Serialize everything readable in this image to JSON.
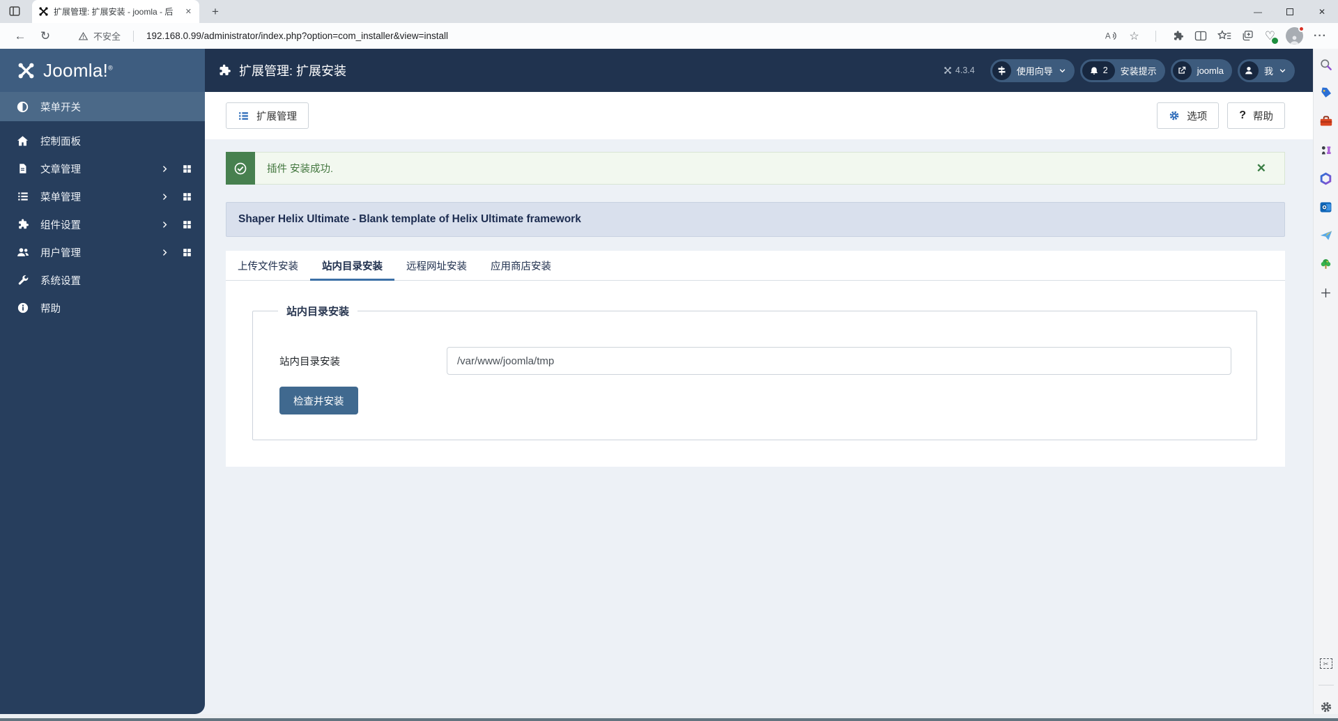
{
  "browser": {
    "tab": {
      "title": "扩展管理: 扩展安装 - joomla - 后"
    },
    "nav": {
      "security_label": "不安全",
      "url": "192.168.0.99/administrator/index.php?option=com_installer&view=install"
    }
  },
  "glyphs": {
    "back": "←",
    "refresh": "↻",
    "star": "☆",
    "dots": "···",
    "new_tab": "+",
    "close": "✕",
    "minimize": "—",
    "heart": "♡",
    "question": "?",
    "scissors": "✂"
  },
  "edge_sidebar": {
    "icons": [
      "search-icon",
      "shopping-tag-icon",
      "toolbox-icon",
      "games-icon",
      "microsoft-365-icon",
      "outlook-icon",
      "paper-plane-icon",
      "tree-icon",
      "add-icon",
      "screenshot-icon",
      "settings-icon"
    ]
  },
  "admin": {
    "logo": "Joomla!",
    "logo_reg": "®",
    "page_title": "扩展管理: 扩展安装",
    "version": "4.3.4",
    "pills": {
      "tour": "使用向导",
      "notices": "安装提示",
      "notices_count": "2",
      "site": "joomla",
      "user": "我"
    },
    "sidebar": {
      "items": [
        {
          "label": "菜单开关"
        },
        {
          "label": "控制面板"
        },
        {
          "label": "文章管理"
        },
        {
          "label": "菜单管理"
        },
        {
          "label": "组件设置"
        },
        {
          "label": "用户管理"
        },
        {
          "label": "系统设置"
        },
        {
          "label": "帮助"
        }
      ]
    },
    "toolbar": {
      "manager": "扩展管理",
      "options": "选项",
      "help": "帮助"
    },
    "content": {
      "alert": {
        "text": "插件 安装成功."
      },
      "banner": "Shaper Helix Ultimate - Blank template of Helix Ultimate framework",
      "tabs": [
        {
          "label": "上传文件安装"
        },
        {
          "label": "站内目录安装"
        },
        {
          "label": "远程网址安装"
        },
        {
          "label": "应用商店安装"
        }
      ],
      "form": {
        "legend": "站内目录安装",
        "label": "站内目录安装",
        "value": "/var/www/joomla/tmp",
        "submit": "检查并安装"
      }
    }
  }
}
